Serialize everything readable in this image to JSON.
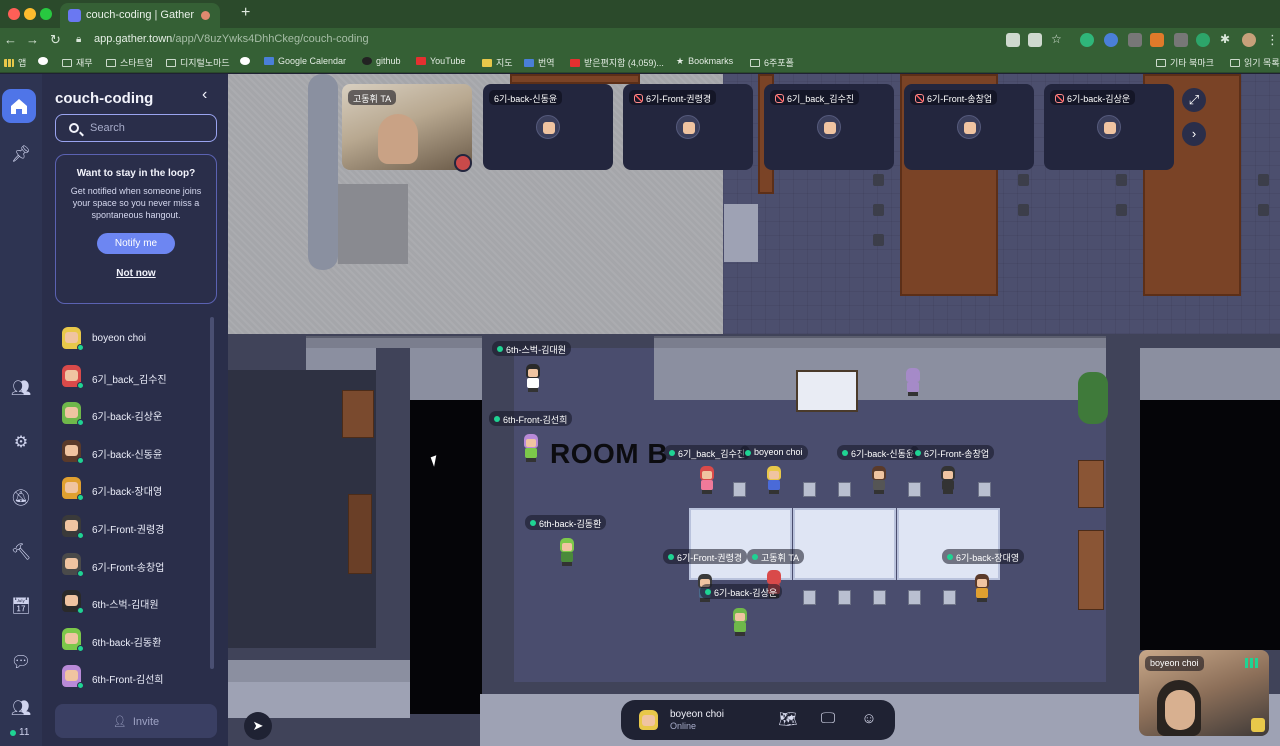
{
  "browser": {
    "tab_title": "couch-coding | Gather",
    "url_host": "app.gather.town",
    "url_path": "/app/V8uzYwks4DhhCkeg/couch-coding",
    "bookmarks": [
      "앱",
      "재무",
      "스타트업",
      "디지털노마드",
      "Google Calendar",
      "github",
      "YouTube",
      "지도",
      "번역",
      "받은편지함 (4,059)...",
      "Bookmarks",
      "6주포폴",
      "기타 북마크",
      "읽기 목록"
    ]
  },
  "rail": {
    "people_count": "11"
  },
  "sidebar": {
    "title": "couch-coding",
    "search_placeholder": "Search",
    "loop_title": "Want to stay in the loop?",
    "loop_text": "Get notified when someone joins your space so you never miss a spontaneous hangout.",
    "notify_label": "Notify me",
    "not_now_label": "Not now",
    "invite_label": "Invite",
    "users": [
      {
        "name": "boyeon choi",
        "color": "#e8c84a"
      },
      {
        "name": "6기_back_김수진",
        "color": "#d94a4a"
      },
      {
        "name": "6기-back-김상운",
        "color": "#6fb84a"
      },
      {
        "name": "6기-back-신동윤",
        "color": "#5a3a2a"
      },
      {
        "name": "6기-back-장대영",
        "color": "#e0a030"
      },
      {
        "name": "6기-Front-권령경",
        "color": "#3a3a3a"
      },
      {
        "name": "6기-Front-송창업",
        "color": "#4a4a4a"
      },
      {
        "name": "6th-스벅-김대원",
        "color": "#2a2a2a"
      },
      {
        "name": "6th-back-김동환",
        "color": "#7cc84a"
      },
      {
        "name": "6th-Front-김선희",
        "color": "#b98ad8"
      }
    ]
  },
  "videos": [
    {
      "label": "고동휘 TA",
      "muted": false
    },
    {
      "label": "6기-back-신동윤",
      "muted": false
    },
    {
      "label": "6기-Front-권령경",
      "muted": true
    },
    {
      "label": "6기_back_김수진",
      "muted": true
    },
    {
      "label": "6기-Front-송창업",
      "muted": true
    },
    {
      "label": "6기-back-김상운",
      "muted": true
    }
  ],
  "map": {
    "room_label": "ROOM B",
    "tags": [
      "6th-스벅-김대원",
      "6th-Front-김선희",
      "6기_back_김수진",
      "boyeon choi",
      "6기-back-신동윤",
      "6기-Front-송창업",
      "6th-back-김동환",
      "6기-Front-권령경",
      "고동휘 TA",
      "6기-back-장대영",
      "6기-back-김상운"
    ]
  },
  "self": {
    "name": "boyeon choi",
    "status": "Online",
    "video_label": "boyeon choi"
  }
}
